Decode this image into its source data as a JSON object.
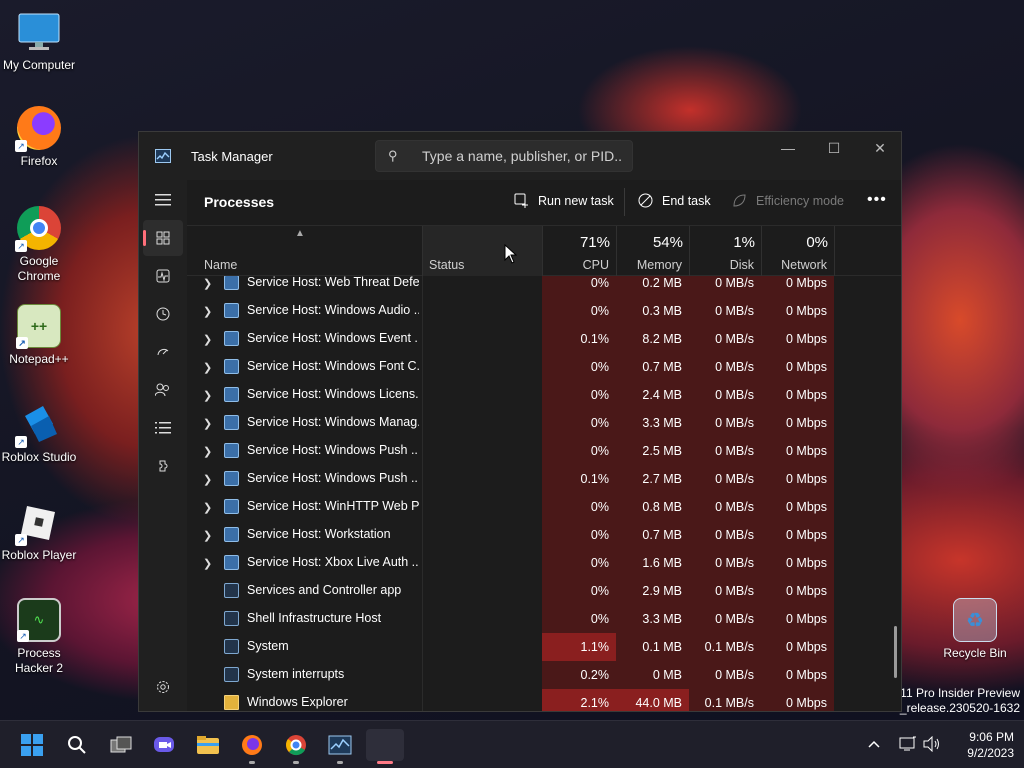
{
  "desktop": {
    "icons": [
      {
        "label": "My Computer",
        "icon": "monitor-icon"
      },
      {
        "label": "Firefox",
        "icon": "firefox-icon"
      },
      {
        "label": "Google Chrome",
        "icon": "chrome-icon"
      },
      {
        "label": "Notepad++",
        "icon": "notepadpp-icon"
      },
      {
        "label": "Roblox Studio",
        "icon": "roblox-studio-icon"
      },
      {
        "label": "Roblox Player",
        "icon": "roblox-player-icon"
      },
      {
        "label": "Process Hacker 2",
        "icon": "process-hacker-icon"
      },
      {
        "label": "Recycle Bin",
        "icon": "recycle-bin-icon"
      }
    ],
    "watermark": {
      "line1": "11 Pro Insider Preview",
      "line2": "n_release.230520-1632"
    }
  },
  "window": {
    "title": "Task Manager",
    "search_placeholder": "Type a name, publisher, or PID...",
    "controls": {
      "minimize": "—",
      "maximize": "☐",
      "close": "✕"
    }
  },
  "nav": {
    "items": [
      "hamburger-icon",
      "processes-icon",
      "performance-icon",
      "app-history-icon",
      "startup-apps-icon",
      "users-icon",
      "details-icon",
      "services-icon",
      "settings-icon"
    ],
    "active": "processes-icon"
  },
  "commandbar": {
    "page_title": "Processes",
    "run_new_task": "Run new task",
    "end_task": "End task",
    "efficiency_mode": "Efficiency mode"
  },
  "columns": {
    "name": "Name",
    "status": "Status",
    "cpu": {
      "label": "CPU",
      "pct": "71%"
    },
    "memory": {
      "label": "Memory",
      "pct": "54%"
    },
    "disk": {
      "label": "Disk",
      "pct": "1%"
    },
    "network": {
      "label": "Network",
      "pct": "0%"
    }
  },
  "rows": [
    {
      "name": "Service Host: Web Threat Defe...",
      "expandable": true,
      "icon": "gear",
      "cpu": "0%",
      "mem": "0.2 MB",
      "disk": "0 MB/s",
      "net": "0 Mbps"
    },
    {
      "name": "Service Host: Windows Audio ...",
      "expandable": true,
      "icon": "gear",
      "cpu": "0%",
      "mem": "0.3 MB",
      "disk": "0 MB/s",
      "net": "0 Mbps"
    },
    {
      "name": "Service Host: Windows Event ...",
      "expandable": true,
      "icon": "gear",
      "cpu": "0.1%",
      "mem": "8.2 MB",
      "disk": "0 MB/s",
      "net": "0 Mbps"
    },
    {
      "name": "Service Host: Windows Font C...",
      "expandable": true,
      "icon": "gear",
      "cpu": "0%",
      "mem": "0.7 MB",
      "disk": "0 MB/s",
      "net": "0 Mbps"
    },
    {
      "name": "Service Host: Windows Licens...",
      "expandable": true,
      "icon": "gear",
      "cpu": "0%",
      "mem": "2.4 MB",
      "disk": "0 MB/s",
      "net": "0 Mbps"
    },
    {
      "name": "Service Host: Windows Manag...",
      "expandable": true,
      "icon": "gear",
      "cpu": "0%",
      "mem": "3.3 MB",
      "disk": "0 MB/s",
      "net": "0 Mbps"
    },
    {
      "name": "Service Host: Windows Push ...",
      "expandable": true,
      "icon": "gear",
      "cpu": "0%",
      "mem": "2.5 MB",
      "disk": "0 MB/s",
      "net": "0 Mbps"
    },
    {
      "name": "Service Host: Windows Push ...",
      "expandable": true,
      "icon": "gear",
      "cpu": "0.1%",
      "mem": "2.7 MB",
      "disk": "0 MB/s",
      "net": "0 Mbps"
    },
    {
      "name": "Service Host: WinHTTP Web P...",
      "expandable": true,
      "icon": "gear",
      "cpu": "0%",
      "mem": "0.8 MB",
      "disk": "0 MB/s",
      "net": "0 Mbps"
    },
    {
      "name": "Service Host: Workstation",
      "expandable": true,
      "icon": "gear",
      "cpu": "0%",
      "mem": "0.7 MB",
      "disk": "0 MB/s",
      "net": "0 Mbps"
    },
    {
      "name": "Service Host: Xbox Live Auth ...",
      "expandable": true,
      "icon": "gear",
      "cpu": "0%",
      "mem": "1.6 MB",
      "disk": "0 MB/s",
      "net": "0 Mbps"
    },
    {
      "name": "Services and Controller app",
      "expandable": false,
      "icon": "sys",
      "cpu": "0%",
      "mem": "2.9 MB",
      "disk": "0 MB/s",
      "net": "0 Mbps"
    },
    {
      "name": "Shell Infrastructure Host",
      "expandable": false,
      "icon": "sys",
      "cpu": "0%",
      "mem": "3.3 MB",
      "disk": "0 MB/s",
      "net": "0 Mbps"
    },
    {
      "name": "System",
      "expandable": false,
      "icon": "sys",
      "cpu": "1.1%",
      "mem": "0.1 MB",
      "disk": "0.1 MB/s",
      "net": "0 Mbps",
      "cpu_hot": true
    },
    {
      "name": "System interrupts",
      "expandable": false,
      "icon": "sys",
      "cpu": "0.2%",
      "mem": "0 MB",
      "disk": "0 MB/s",
      "net": "0 Mbps"
    },
    {
      "name": "Windows Explorer",
      "expandable": false,
      "icon": "folder",
      "cpu": "2.1%",
      "mem": "44.0 MB",
      "disk": "0.1 MB/s",
      "net": "0 Mbps",
      "cpu_hot": true,
      "mem_hot": true
    }
  ],
  "colors": {
    "heat_low": "#4a1818",
    "heat_mid": "#6b1c1c",
    "heat_high": "#8a1f1f",
    "accent": "#ff6f7a"
  },
  "taskbar": {
    "apps": [
      "windows-start-icon",
      "search-icon",
      "task-view-icon",
      "teams-chat-icon",
      "file-explorer-icon",
      "firefox-icon",
      "chrome-icon",
      "task-manager-icon",
      "blank-window-icon"
    ],
    "clock": {
      "time": "9:06 PM",
      "date": "9/2/2023"
    }
  }
}
